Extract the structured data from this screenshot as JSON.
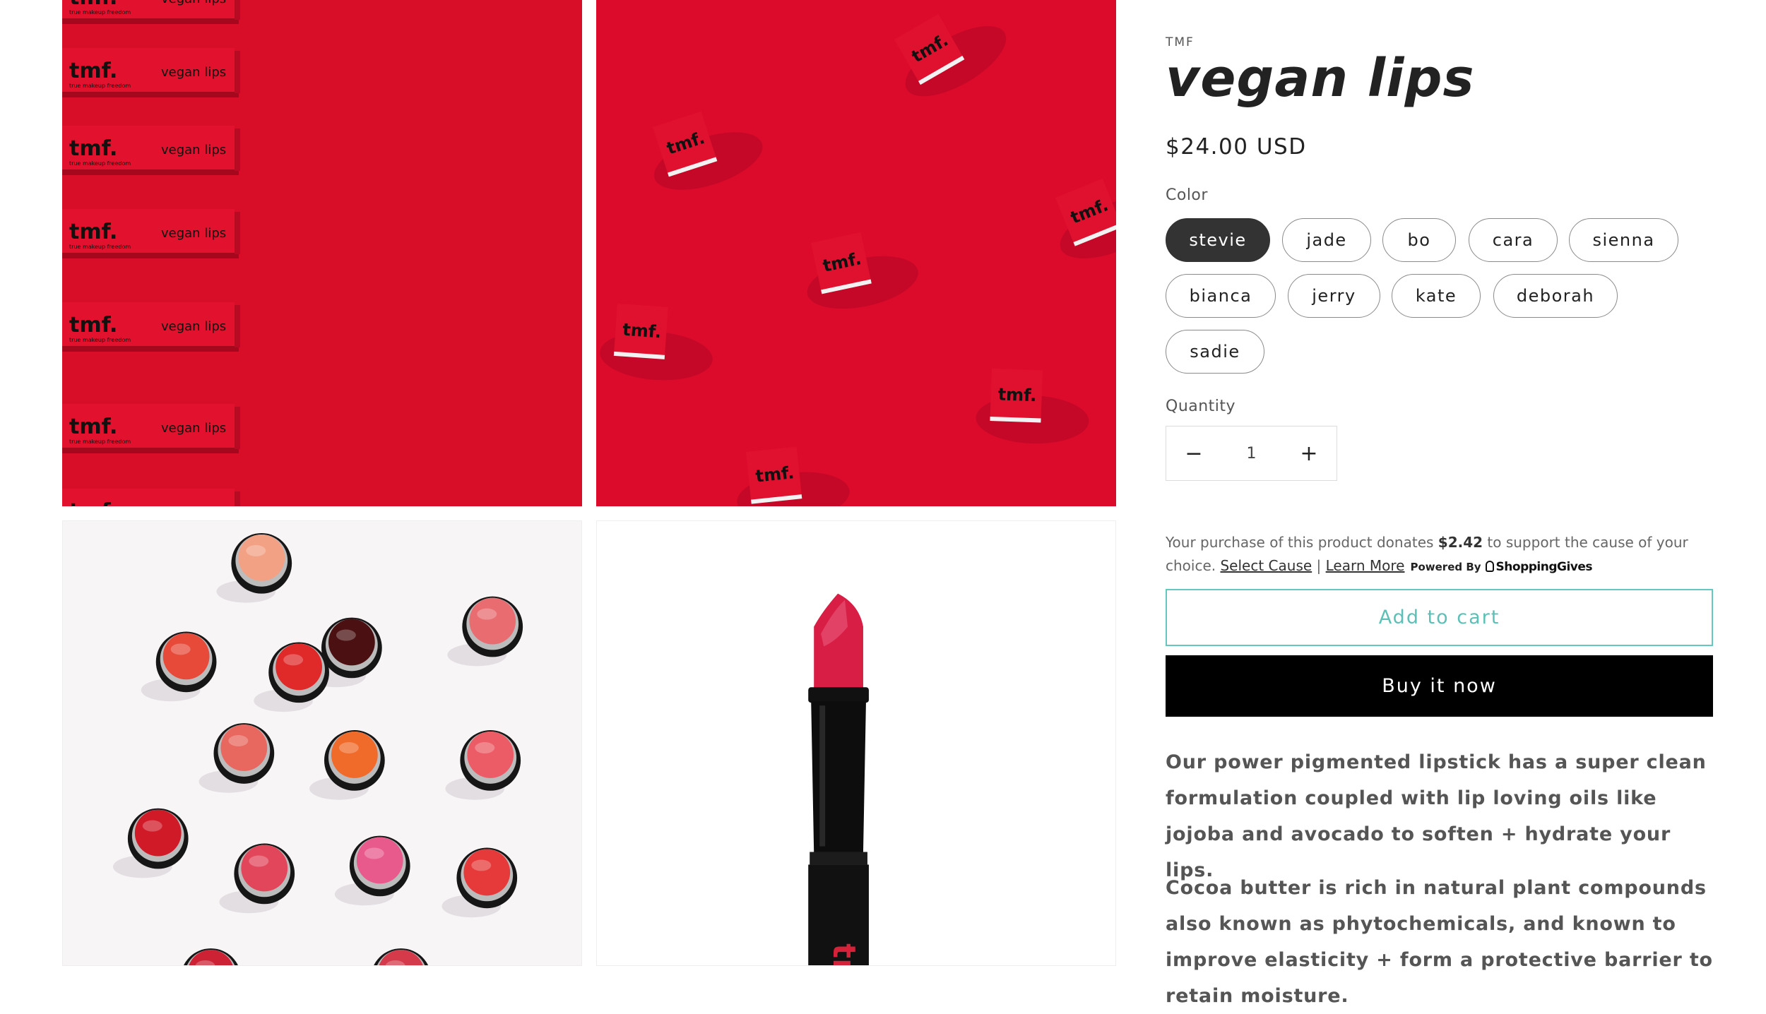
{
  "gallery": {
    "images": [
      {
        "name": "tmf-vegan-lips-boxes-row",
        "box_brand": "tmf.",
        "box_tagline": "true makeup freedom",
        "box_label": "vegan lips"
      },
      {
        "name": "tmf-scattered-cubes",
        "cube_brand": "tmf."
      },
      {
        "name": "lipstick-bullets-flatlay"
      },
      {
        "name": "single-red-lipstick",
        "tube_brand": "tmf."
      }
    ]
  },
  "product": {
    "vendor": "TMF",
    "title": "vegan lips",
    "price": "$24.00 USD",
    "color_label": "Color",
    "colors": [
      "stevie",
      "jade",
      "bo",
      "cara",
      "sienna",
      "bianca",
      "jerry",
      "kate",
      "deborah",
      "sadie"
    ],
    "selected_color": "stevie",
    "quantity_label": "Quantity",
    "quantity": "1",
    "decrease_symbol": "−",
    "increase_symbol": "+"
  },
  "donation": {
    "text_before": "Your purchase of this product donates ",
    "amount": "$2.42",
    "text_after": " to support the cause of your choice. ",
    "select_cause": "Select Cause",
    "separator": " | ",
    "learn_more": "Learn More",
    "powered_by": "Powered By",
    "brand": "ShoppingGives"
  },
  "buttons": {
    "add_to_cart": "Add to cart",
    "buy_now": "Buy it now"
  },
  "description": {
    "paragraphs": [
      "Our power pigmented lipstick has a super clean formulation coupled with lip loving oils like jojoba and avocado to soften + hydrate your lips.",
      "Cocoa butter is rich in natural plant compounds also known as phytochemicals, and known to improve elasticity + form a protective barrier to retain moisture."
    ]
  },
  "colors": {
    "accent": "#5cc0b6",
    "buy_now_bg": "#000000",
    "selected_swatch_bg": "#333333",
    "product_red": "#d80d28"
  }
}
